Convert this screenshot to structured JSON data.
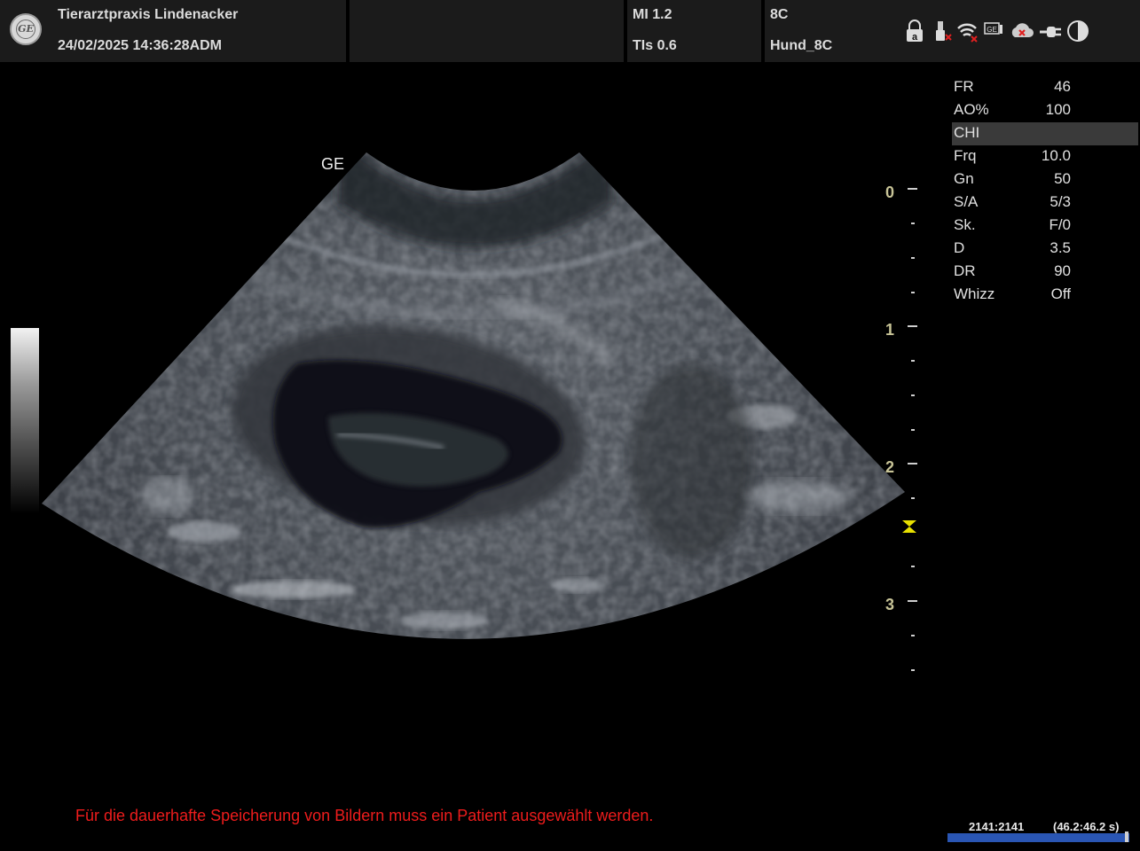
{
  "header": {
    "clinic_name": "Tierarztpraxis Lindenacker",
    "datetime_operator": "24/02/2025 14:36:28ADM",
    "mi": "MI 1.2",
    "tis": "TIs 0.6",
    "probe": "8C",
    "preset": "Hund_8C",
    "logo_text": "GE",
    "status_icons": [
      "lock-icon",
      "usb-icon",
      "wifi-icon",
      "network-icon",
      "cloud-icon",
      "connector-icon",
      "contrast-icon"
    ]
  },
  "image": {
    "vendor_label": "GE"
  },
  "depth_scale": {
    "labels": [
      "0",
      "1",
      "2",
      "3"
    ],
    "unit_color": "#c8c497",
    "focus_color": "#e8e000"
  },
  "parameters": [
    {
      "label": "FR",
      "value": "46"
    },
    {
      "label": "AO%",
      "value": "100"
    },
    {
      "label": "CHI",
      "value": "",
      "highlighted": true
    },
    {
      "label": "Frq",
      "value": "10.0"
    },
    {
      "label": "Gn",
      "value": "50"
    },
    {
      "label": "S/A",
      "value": "5/3"
    },
    {
      "label": "Sk.",
      "value": "F/0"
    },
    {
      "label": "D",
      "value": "3.5"
    },
    {
      "label": "DR",
      "value": "90"
    },
    {
      "label": "Whizz",
      "value": "Off"
    }
  ],
  "footer": {
    "warning": "Für die dauerhafte Speicherung von Bildern muss ein Patient ausgewählt werden.",
    "cine_frames": "2141:2141",
    "cine_time": "(46.2:46.2 s)",
    "cine_color": "#2a56b4"
  }
}
